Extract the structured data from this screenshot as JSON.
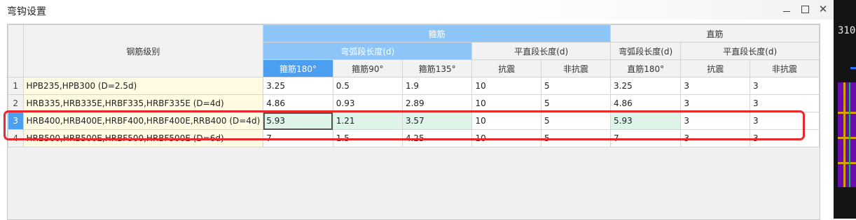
{
  "window": {
    "title": "弯钩设置"
  },
  "background_app": {
    "number_text": "310"
  },
  "table": {
    "headers": {
      "grade": "钢筋级别",
      "stirrup": "箍筋",
      "straight": "直筋",
      "stirrup_arc": "弯弧段长度(d)",
      "stirrup_flat": "平直段长度(d)",
      "straight_arc": "弯弧段长度(d)",
      "straight_flat": "平直段长度(d)",
      "s180": "箍筋180°",
      "s90": "箍筋90°",
      "s135": "箍筋135°",
      "seismic": "抗震",
      "nonseismic": "非抗震",
      "st180": "直筋180°",
      "st_seismic": "抗震",
      "st_nonseismic": "非抗震"
    },
    "rows": [
      {
        "num": "1",
        "grade": "HPB235,HPB300 (D=2.5d)",
        "s180": "3.25",
        "s90": "0.5",
        "s135": "1.9",
        "seismic": "10",
        "nonseismic": "5",
        "st180": "3.25",
        "st_seismic": "3",
        "st_nonseismic": "3"
      },
      {
        "num": "2",
        "grade": "HRB335,HRB335E,HRBF335,HRBF335E (D=4d)",
        "s180": "4.86",
        "s90": "0.93",
        "s135": "2.89",
        "seismic": "10",
        "nonseismic": "5",
        "st180": "4.86",
        "st_seismic": "3",
        "st_nonseismic": "3"
      },
      {
        "num": "3",
        "grade": "HRB400,HRB400E,HRBF400,HRBF400E,RRB400 (D=4d)",
        "s180": "5.93",
        "s90": "1.21",
        "s135": "3.57",
        "seismic": "10",
        "nonseismic": "5",
        "st180": "5.93",
        "st_seismic": "3",
        "st_nonseismic": "3"
      },
      {
        "num": "4",
        "grade": "HRB500,HRB500E,HRBF500,HRBF500E (D=6d)",
        "s180": "7",
        "s90": "1.5",
        "s135": "4.25",
        "seismic": "10",
        "nonseismic": "5",
        "st180": "7",
        "st_seismic": "3",
        "st_nonseismic": "3"
      }
    ],
    "selected_row": "3"
  },
  "colors": {
    "header_blue": "#8ec5f8",
    "header_selected_blue": "#4a9ff0",
    "grade_cell_bg": "#fffbe3",
    "selected_row_highlight": "#dff4e8",
    "annotation_red": "#e8282c"
  },
  "icons": {
    "minimize": "minimize-icon",
    "maximize": "maximize-icon",
    "close": "close-icon"
  }
}
